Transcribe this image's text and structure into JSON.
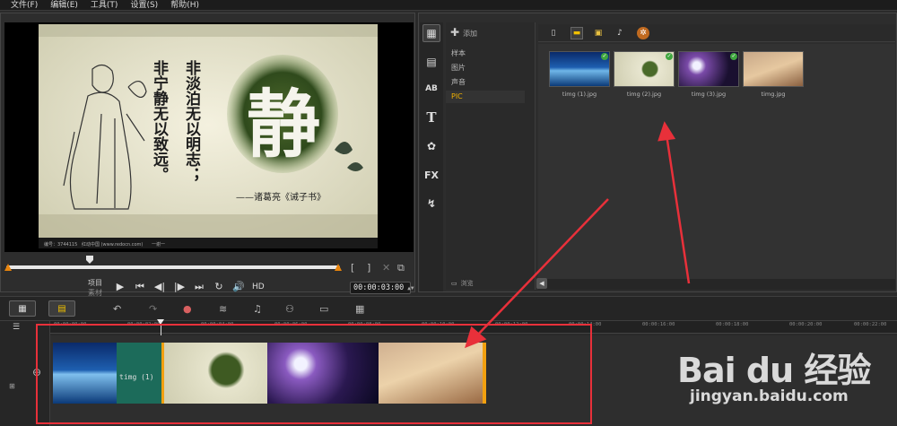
{
  "menu": {
    "items": [
      "文件(F)",
      "编辑(E)",
      "工具(T)",
      "设置(S)",
      "帮助(H)"
    ]
  },
  "preview": {
    "image_caption_left": "编号：3744115",
    "image_caption_mid": "红动中国 (www.redocn.com)",
    "image_caption_right": "一谢一",
    "calligraphy_char": "静",
    "poem_col1": "非淡泊无以明志；",
    "poem_col2": "非宁静无以致远。",
    "attribution": "——诸葛亮《诫子书》",
    "mode_project": "项目",
    "mode_clip": "素材",
    "hd_label": "HD",
    "timecode": "00:00:03:00",
    "mark_in": "[",
    "mark_out": "]"
  },
  "library": {
    "add_label": "添加",
    "folders": [
      "样本",
      "图片",
      "声音",
      "PIC"
    ],
    "active_folder": "PIC",
    "browse_label": "浏览",
    "thumbnails": [
      {
        "name": "timg (1).jpg"
      },
      {
        "name": "timg (2).jpg"
      },
      {
        "name": "timg (3).jpg"
      },
      {
        "name": "timg.jpg"
      }
    ],
    "side_tabs": [
      "media-icon",
      "instant-project-icon",
      "transition-icon",
      "title-icon",
      "graphic-icon",
      "filter-icon",
      "path-icon"
    ],
    "title_tab_glyph": "T",
    "filter_tab_glyph": "FX",
    "transition_tab_glyph": "AB"
  },
  "timeline": {
    "ruler_labels": [
      "00:00:00:00",
      "00:00:02:00",
      "00:00:04:00",
      "00:00:06:00",
      "00:00:08:00",
      "00:00:10:00",
      "00:00:12:00",
      "00:00:14:00",
      "00:00:16:00",
      "00:00:18:00",
      "00:00:20:00",
      "00:00:22:00"
    ],
    "clip1_label": "timg (1)"
  },
  "watermark": {
    "main": "Bai du 经验",
    "sub": "jingyan.baidu.com"
  },
  "colors": {
    "accent_orange": "#f2a010",
    "annotation_red": "#e8303a",
    "folder_active": "#f0b000",
    "check_green": "#3fa63f"
  }
}
